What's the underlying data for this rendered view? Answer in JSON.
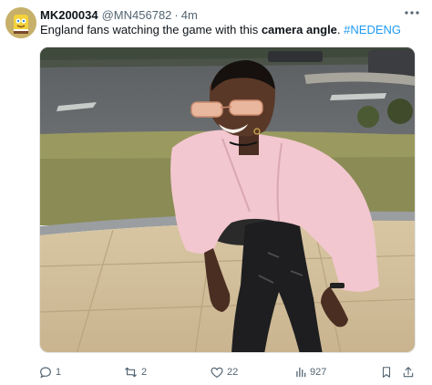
{
  "tweet": {
    "display_name": "MK200034",
    "handle": "@MN456782",
    "separator": "·",
    "time": "4m",
    "text_prefix": "England fans watching the game with this ",
    "text_bold": "camera angle",
    "text_period": ".",
    "hashtag": "#NEDENG",
    "more_icon": "more-dots-icon",
    "media_description_icon": "photo"
  },
  "actions": {
    "reply_count": "1",
    "retweet_count": "2",
    "like_count": "22",
    "views_count": "927"
  },
  "colors": {
    "text": "#0f1419",
    "secondary": "#536471",
    "accent": "#1d9bf0"
  }
}
